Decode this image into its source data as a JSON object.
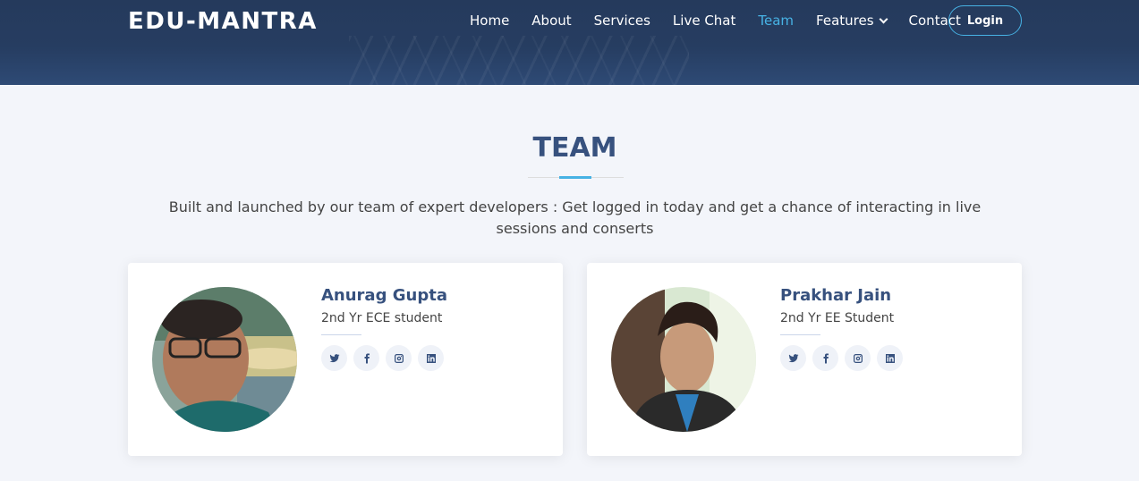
{
  "header": {
    "logo": "EDU-MANTRA",
    "nav": [
      {
        "label": "Home"
      },
      {
        "label": "About"
      },
      {
        "label": "Services"
      },
      {
        "label": "Live Chat"
      },
      {
        "label": "Team",
        "active": true
      },
      {
        "label": "Features",
        "has_dropdown": true
      },
      {
        "label": "Contact"
      }
    ],
    "login_label": "Login"
  },
  "section": {
    "title": "TEAM",
    "description": "Built and launched by our team of expert developers : Get logged in today and get a chance of interacting in live sessions and conserts"
  },
  "team": [
    {
      "name": "Anurag Gupta",
      "role": "2nd Yr ECE student",
      "socials": [
        "twitter-icon",
        "facebook-icon",
        "instagram-icon",
        "linkedin-icon"
      ]
    },
    {
      "name": "Prakhar Jain",
      "role": "2nd Yr EE Student",
      "socials": [
        "twitter-icon",
        "facebook-icon",
        "instagram-icon",
        "linkedin-icon"
      ]
    }
  ],
  "colors": {
    "accent": "#47b2e4",
    "brand": "#37517e",
    "header_bg": "#253a5c"
  }
}
